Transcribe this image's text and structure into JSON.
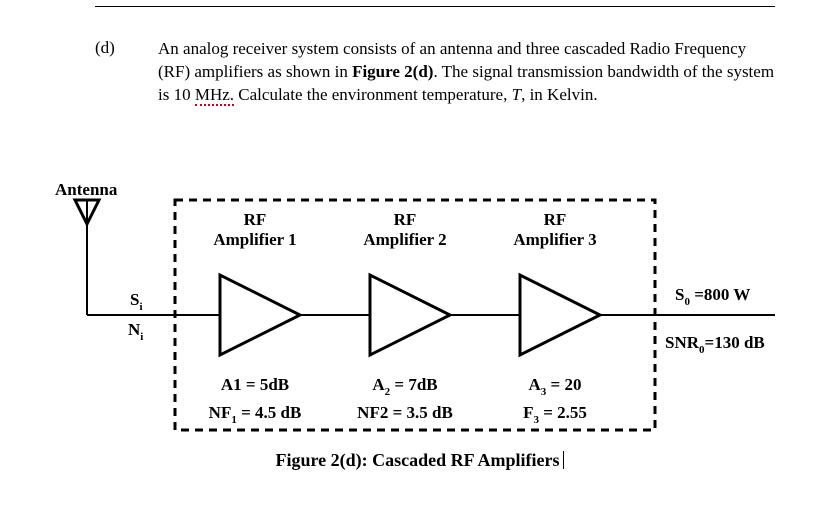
{
  "question": {
    "label": "(d)",
    "text_parts": {
      "p1": "An analog receiver system consists of an antenna and three cascaded Radio Frequency (RF) amplifiers as shown in ",
      "fig_ref": "Figure 2(d)",
      "p2": ". The signal transmission bandwidth of the system is 10 ",
      "mhz": "MHz.",
      "p3": " Calculate the environment temperature, ",
      "Tvar": "T",
      "p4": ", in Kelvin."
    }
  },
  "diagram": {
    "antenna_label": "Antenna",
    "input_S": "S",
    "input_S_sub": "i",
    "input_N": "N",
    "input_N_sub": "i",
    "amps": [
      {
        "title1": "RF",
        "title2": "Amplifier 1",
        "gain": "A1 = 5dB",
        "nf": "NF",
        "nf_sub": "1",
        "nf_rest": "= 4.5 dB"
      },
      {
        "title1": "RF",
        "title2": "Amplifier 2",
        "gain": "A",
        "gain_sub": "2",
        "gain_rest": "= 7dB",
        "nf": "NF2 = 3.5 dB"
      },
      {
        "title1": "RF",
        "title2": "Amplifier 3",
        "gain": "A",
        "gain_sub": "3",
        "gain_rest": "= 20",
        "nf": "F",
        "nf_sub": "3",
        "nf_rest": "= 2.55"
      }
    ],
    "output_S": "S",
    "output_S_sub": "0",
    "output_S_val": "=800 W",
    "output_SNR": "SNR",
    "output_SNR_sub": "0",
    "output_SNR_val": "=130 dB",
    "caption": "Figure 2(d): Cascaded RF Amplifiers"
  },
  "chart_data": {
    "type": "diagram",
    "system": "Cascaded RF Amplifier chain with antenna input",
    "bandwidth_MHz": 10,
    "stages": [
      {
        "name": "RF Amplifier 1",
        "gain_dB": 5,
        "noise_figure_dB": 4.5
      },
      {
        "name": "RF Amplifier 2",
        "gain_dB": 7,
        "noise_figure_dB": 3.5
      },
      {
        "name": "RF Amplifier 3",
        "gain": 20,
        "noise_factor": 2.55
      }
    ],
    "inputs": [
      "S_i",
      "N_i"
    ],
    "outputs": {
      "S0_W": 800,
      "SNR0_dB": 130
    },
    "unknown": "environment temperature T (Kelvin)"
  }
}
